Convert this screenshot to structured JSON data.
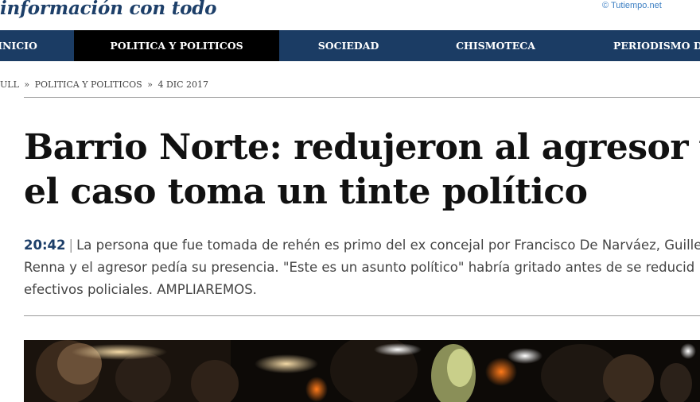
{
  "header": {
    "tagline": "información con todo",
    "weather_link": "© Tutiempo.net"
  },
  "nav": {
    "items": [
      {
        "label": "INICIO",
        "active": false
      },
      {
        "label": "POLITICA Y POLITICOS",
        "active": true
      },
      {
        "label": "SOCIEDAD",
        "active": false
      },
      {
        "label": "CHISMOTECA",
        "active": false
      },
      {
        "label": "PERIODISMO DE",
        "active": false
      }
    ]
  },
  "breadcrumb": {
    "section_fragment": "ULL",
    "separator": "»",
    "category": "POLITICA Y POLITICOS",
    "date": "4 DIC 2017"
  },
  "article": {
    "headline_line1": "Barrio Norte: redujeron al agresor y",
    "headline_line2": "el caso toma un tinte político",
    "time": "20:42",
    "divider": "|",
    "summary_line1": "La persona que fue tomada de rehén es primo del ex concejal por Francisco De Narváez, Guille",
    "summary_line2": "Renna y el agresor pedía su presencia. \"Este es un asunto político\" habría gritado antes de se reducid",
    "summary_line3": "efectivos policiales. AMPLIAREMOS.",
    "image_alt": "night-scene-photo"
  },
  "colors": {
    "brand": "#1d3f69",
    "nav_bg": "#1b3c64",
    "nav_active": "#000000",
    "link": "#3c7fc3"
  }
}
